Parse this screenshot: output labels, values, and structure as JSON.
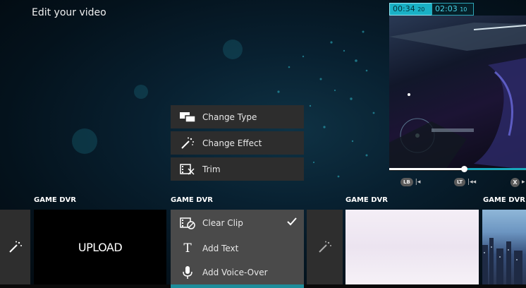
{
  "page": {
    "title": "Edit your video"
  },
  "preview": {
    "current_time": "00:34",
    "current_frames": "20",
    "total_time": "02:03",
    "total_frames": "10",
    "progress": 0.55,
    "controls": [
      {
        "button": "LB",
        "icon": "skip-back-icon"
      },
      {
        "button": "LT",
        "icon": "rewind-icon"
      },
      {
        "button": "X",
        "icon": "play-icon"
      }
    ]
  },
  "context_menu": {
    "items": [
      {
        "label": "Change Type",
        "icon": "change-type-icon"
      },
      {
        "label": "Change Effect",
        "icon": "magic-wand-icon"
      },
      {
        "label": "Trim",
        "icon": "trim-icon"
      }
    ]
  },
  "clip_menu": {
    "items": [
      {
        "label": "Clear Clip",
        "icon": "clear-clip-icon",
        "checked": true
      },
      {
        "label": "Add Text",
        "icon": "text-icon"
      },
      {
        "label": "Add Voice-Over",
        "icon": "microphone-icon"
      }
    ]
  },
  "timeline": {
    "section_label": "GAME DVR",
    "upload_label": "UPLOAD"
  },
  "colors": {
    "accent": "#1ab1c6",
    "menu_bg": "#2d2d2d",
    "menu_selected_bg": "#4a4a4a"
  }
}
